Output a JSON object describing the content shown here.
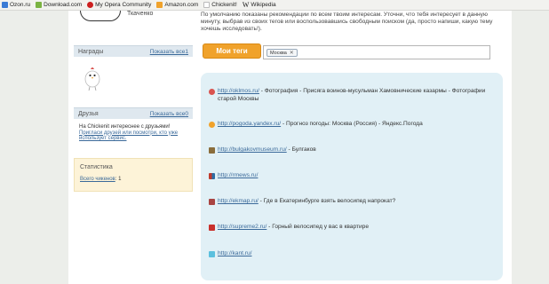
{
  "bookmarks": [
    {
      "label": "Ozon.ru",
      "color": "#3a7bd5"
    },
    {
      "label": "Download.com",
      "color": "#7bb342"
    },
    {
      "label": "My Opera Community",
      "color": "#cc1f1f"
    },
    {
      "label": "Amazon.com",
      "color": "#f0a22b"
    },
    {
      "label": "Chickenit!",
      "color": "#bbbbbb"
    },
    {
      "label": "Wikipedia",
      "color": "#666666"
    }
  ],
  "profile": {
    "username": "Ткаченко"
  },
  "awards": {
    "title": "Награды",
    "show_all": "Показать все",
    "count": "1"
  },
  "friends": {
    "title": "Друзья",
    "show_all": "Показать все",
    "count": "0",
    "text": "На Chickenit интереснее с друзьями!",
    "invite_link": "Пригласи друзей или посмотри, кто уже использует сервис."
  },
  "stats": {
    "title": "Статистика",
    "label": "Всего чикенов",
    "value": ": 1"
  },
  "intro": {
    "text_before": "По умолчанию показаны рекомендации по всем твоим интересам. Уточни, что тебя интересует в данную минуту, выбрав из своих тегов или воспользовавшись свободным поиском (да, просто напиши, какую тему хочешь исследовать!).",
    "link": ""
  },
  "tags": {
    "button": "Мои теги",
    "chip": "Москва",
    "chip_remove": "✕"
  },
  "recommendations": [
    {
      "url": "http://oklmos.ru/",
      "text": " - Фотография - Присяга воинов-мусульман Хамовнические казармы - Фотографии старой Москвы",
      "icon_color": "#d9534f"
    },
    {
      "url": "http://pogoda.yandex.ru/",
      "text": " - Прогноз погоды: Москва (Россия) - Яндекс.Погода",
      "icon_color": "#f0a22b"
    },
    {
      "url": "http://bulgakovmuseum.ru/",
      "text": " - Булгаков",
      "icon_color": "#8a6d3b"
    },
    {
      "url": "http://rmews.ru/",
      "text": "",
      "icon_color": "#c0392b"
    },
    {
      "url": "http://ekmap.ru/",
      "text": " - Где в Екатеринбурге взять велосипед напрокат?",
      "icon_color": "#a94442"
    },
    {
      "url": "http://supreme2.ru/",
      "text": " - Горный велосипед у вас в квартире",
      "icon_color": "#c9302c"
    },
    {
      "url": "http://kant.ru/",
      "text": "",
      "icon_color": "#5bc0de"
    }
  ]
}
